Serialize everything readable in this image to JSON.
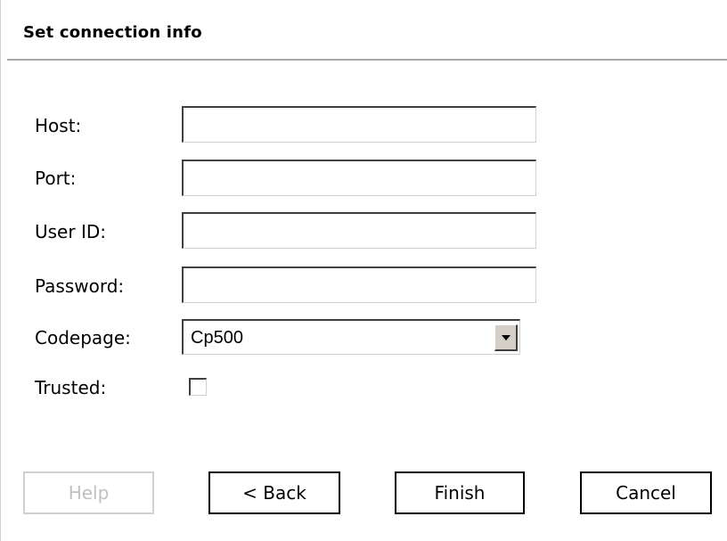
{
  "dialog": {
    "title": "Set connection info"
  },
  "form": {
    "host_label": "Host:",
    "host_value": "",
    "port_label": "Port:",
    "port_value": "",
    "userid_label": "User ID:",
    "userid_value": "",
    "password_label": "Password:",
    "password_value": "",
    "codepage_label": "Codepage:",
    "codepage_value": "Cp500",
    "trusted_label": "Trusted:",
    "trusted_checked": false
  },
  "buttons": {
    "help_label": "Help",
    "help_enabled": false,
    "back_label": "< Back",
    "finish_label": "Finish",
    "cancel_label": "Cancel"
  },
  "icons": {
    "dropdown_arrow": "chevron-down-icon"
  },
  "colors": {
    "divider": "#a8a8a8",
    "disabled_text": "#c0c0c0",
    "control_face": "#d4d0c8"
  }
}
